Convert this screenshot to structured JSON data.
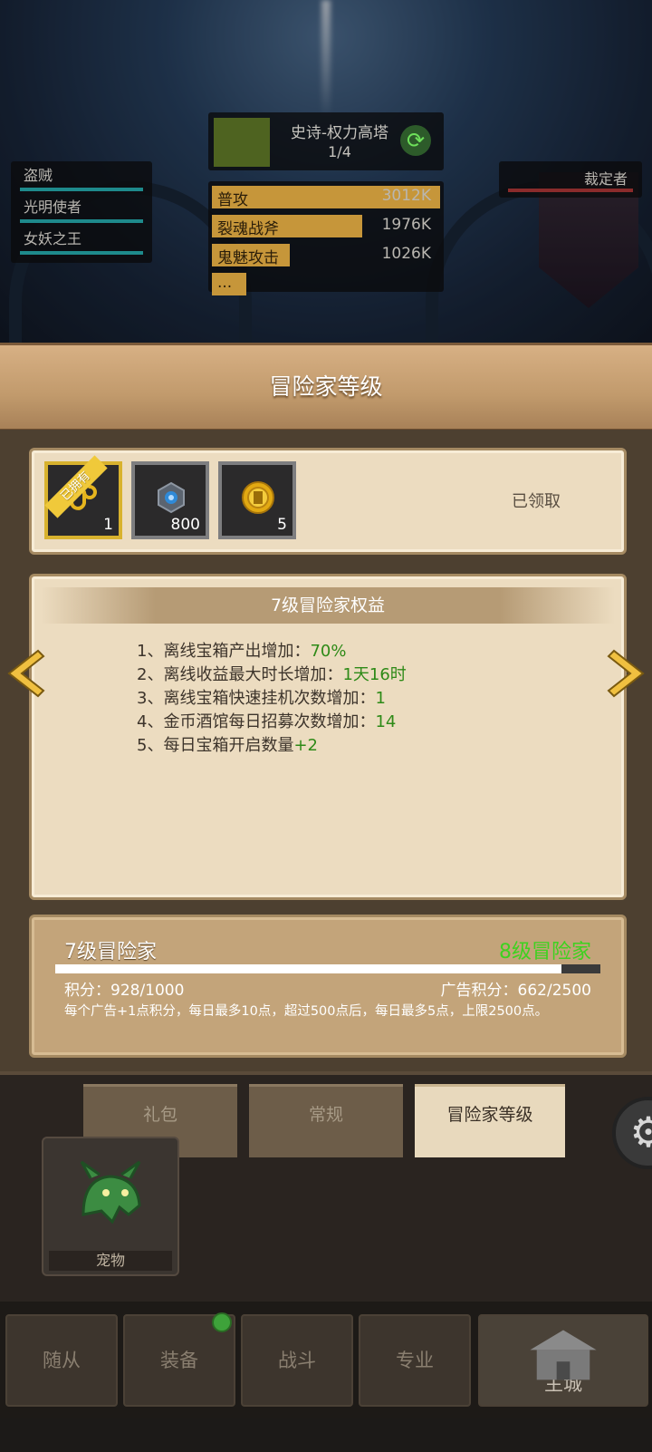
{
  "hud": {
    "left_list": [
      "盗贼",
      "光明使者",
      "女妖之王"
    ],
    "right_name": "裁定者",
    "boss_name": "史诗-权力高塔",
    "boss_progress": "1/4",
    "damage_rows": [
      {
        "label": "普攻",
        "value": "3012K",
        "fraction": 1.0
      },
      {
        "label": "裂魂战斧",
        "value": "1976K",
        "fraction": 0.66
      },
      {
        "label": "鬼魅攻击",
        "value": "1026K",
        "fraction": 0.34
      },
      {
        "label": "...",
        "value": "",
        "fraction": 0.15
      }
    ]
  },
  "panel": {
    "title": "冒险家等级",
    "rewards": {
      "owned_badge": "已拥有",
      "items": [
        {
          "icon": "hook-icon",
          "count": "1"
        },
        {
          "icon": "blue-gem-icon",
          "count": "800"
        },
        {
          "icon": "gold-coin-icon",
          "count": "5"
        }
      ],
      "status": "已领取"
    },
    "benefits": {
      "title": "7级冒险家权益",
      "items": [
        {
          "text": "1、离线宝箱产出增加：",
          "value": "70%"
        },
        {
          "text": "2、离线收益最大时长增加：",
          "value": "1天16时"
        },
        {
          "text": "3、离线宝箱快速挂机次数增加：",
          "value": "1"
        },
        {
          "text": "4、金币酒馆每日招募次数增加：",
          "value": "14"
        },
        {
          "text": "5、每日宝箱开启数量",
          "value": "+2"
        }
      ]
    },
    "progress": {
      "current_level": "7级冒险家",
      "next_level": "8级冒险家",
      "points": "积分：928/1000",
      "points_fraction": 0.928,
      "ad_points": "广告积分：662/2500",
      "note": "每个广告+1点积分，每日最多10点，超过500点后，每日最多5点，上限2500点。"
    }
  },
  "tabs": [
    "礼包",
    "常规",
    "冒险家等级"
  ],
  "pet_label": "宠物",
  "nav": [
    "随从",
    "装备",
    "战斗",
    "专业",
    "主城"
  ],
  "colors": {
    "accent_green": "#3dd21f",
    "benefit_green": "#2e8a17",
    "gold": "#d8b22e"
  }
}
